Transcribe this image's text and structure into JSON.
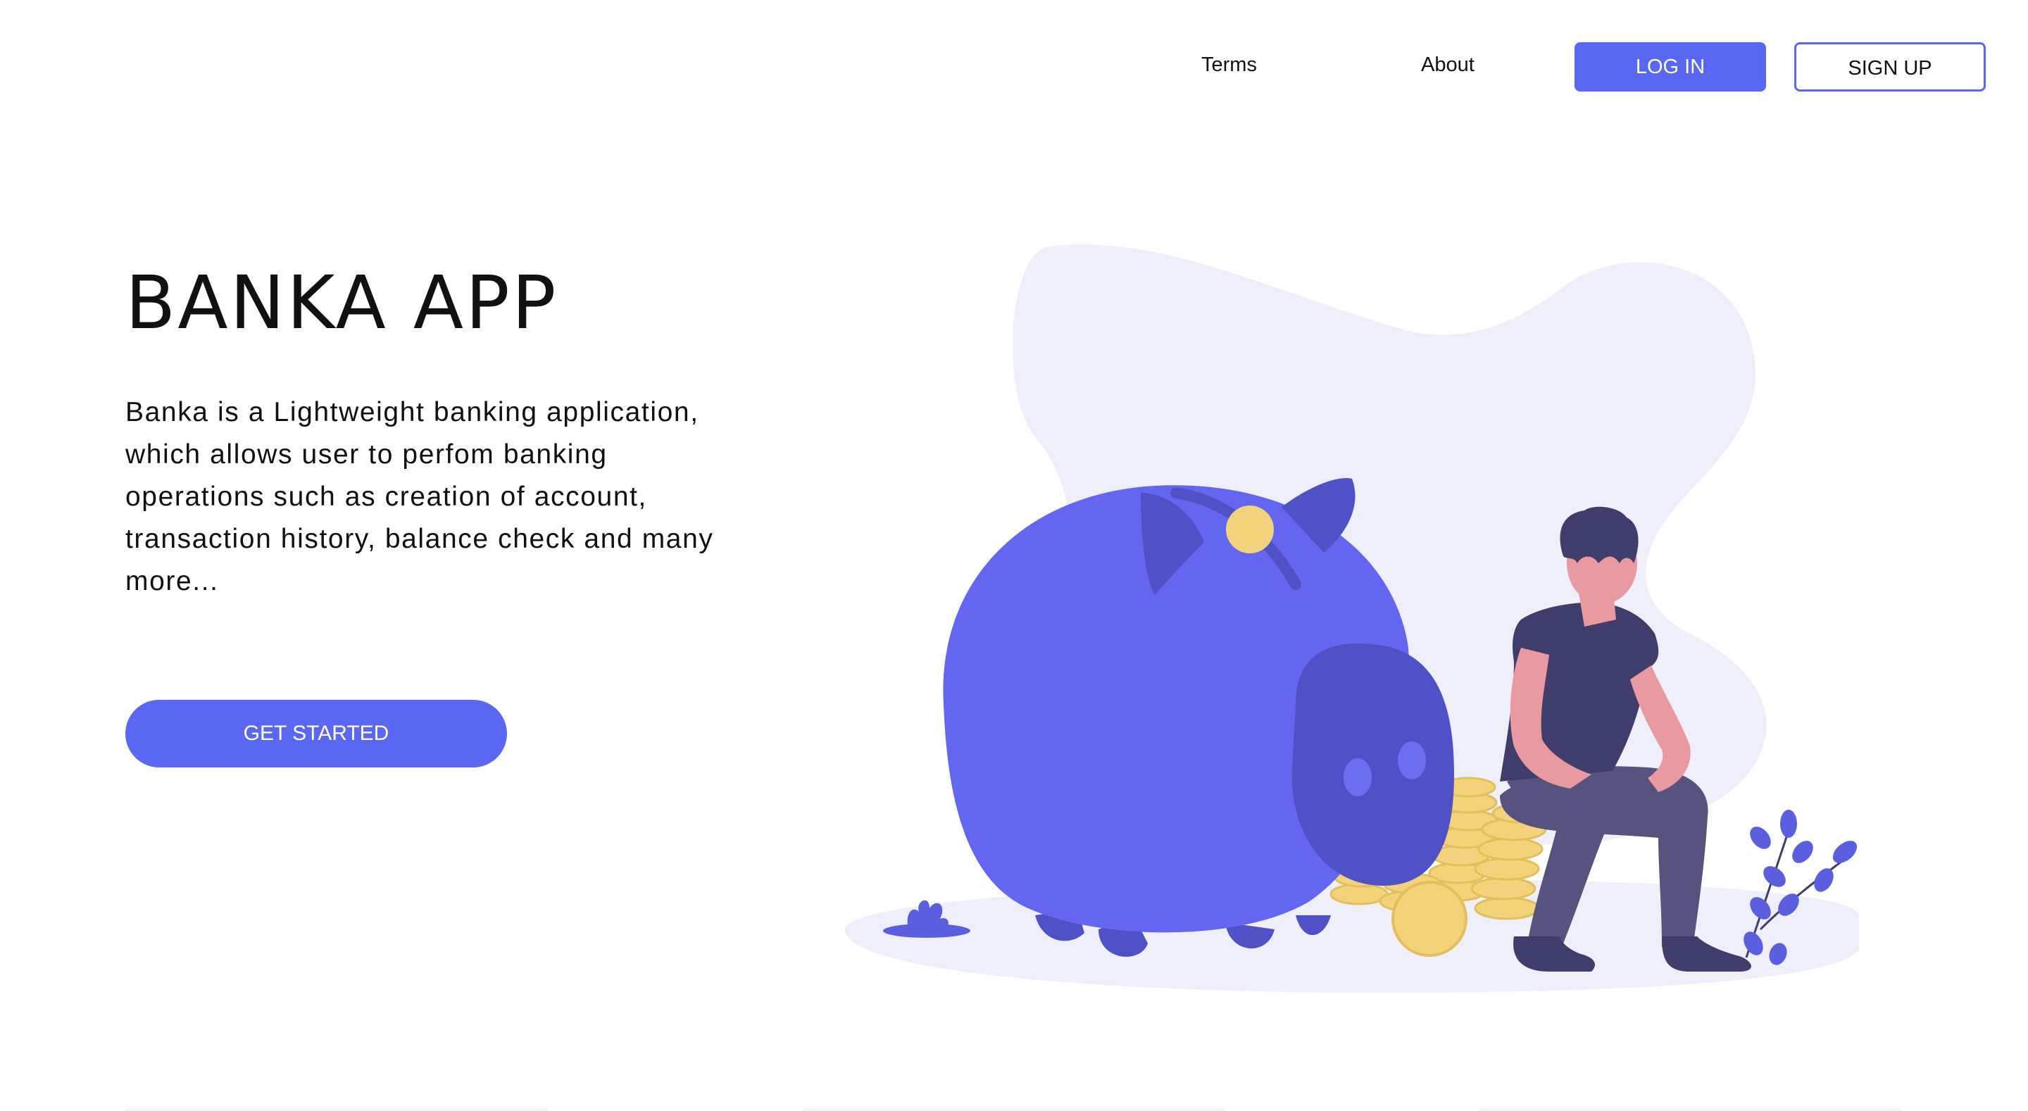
{
  "nav": {
    "terms": "Terms",
    "about": "About",
    "login": "LOG IN",
    "signup": "SIGN UP"
  },
  "hero": {
    "title": "BANKA APP",
    "description": "Banka is a Lightweight banking application, which allows user to perfom banking operations such as creation of account, transaction history, balance check and many more...",
    "cta": "GET STARTED"
  },
  "illustration": {
    "subject": "piggy-bank-with-man-and-coins",
    "colors": {
      "accent": "#5a67f2",
      "pig": "#6366f1",
      "pig_dark": "#4f52c7",
      "coin": "#f2d27a",
      "blob": "#efeffb",
      "skin": "#e89aa0",
      "shirt": "#3f3d6b",
      "pants": "#56547f"
    }
  }
}
